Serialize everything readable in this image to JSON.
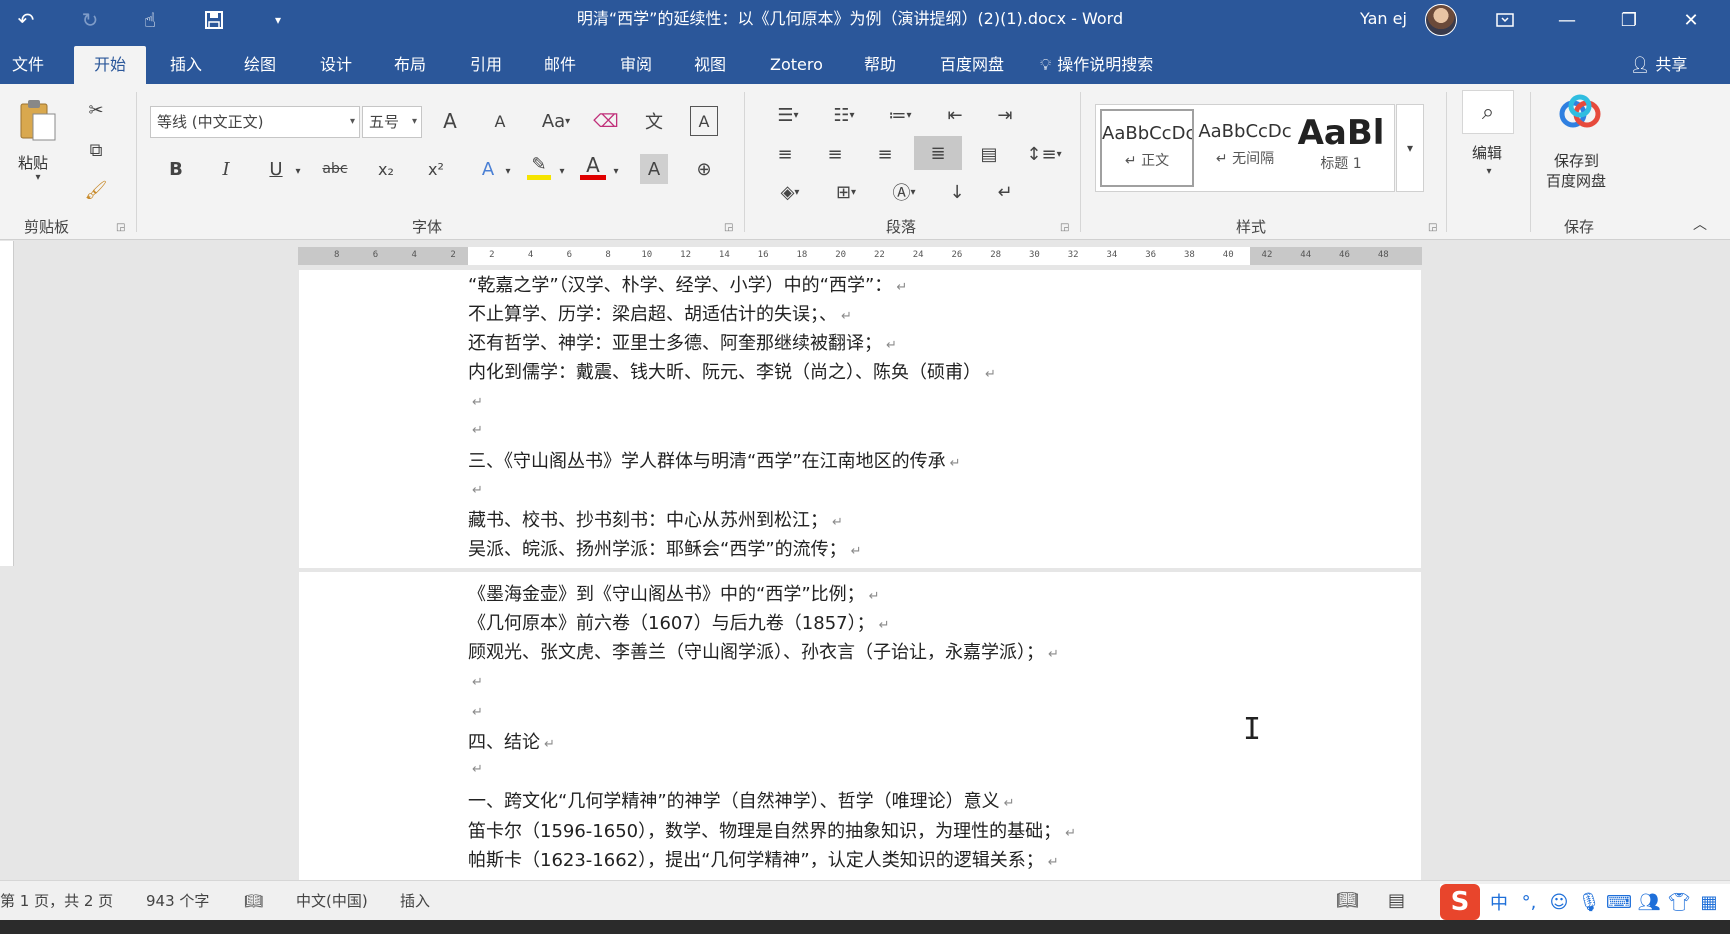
{
  "titlebar": {
    "title": "明清“西学”的延续性：以《几何原本》为例（演讲提纲）(2)(1).docx  -  Word",
    "user": "Yan ej",
    "icons": [
      "undo-icon",
      "redo-icon",
      "touch-mode-icon",
      "save-icon",
      "customize-icon"
    ]
  },
  "menu": {
    "tabs": [
      "文件",
      "开始",
      "插入",
      "绘图",
      "设计",
      "布局",
      "引用",
      "邮件",
      "审阅",
      "视图",
      "Zotero",
      "帮助",
      "百度网盘"
    ],
    "active": "开始",
    "search_label": "操作说明搜索",
    "share_label": "共享"
  },
  "ribbon": {
    "clipboard": {
      "paste_label": "粘贴",
      "group": "剪贴板"
    },
    "font": {
      "name": "等线 (中文正文)",
      "size": "五号",
      "group": "字体",
      "buttons": {
        "bold": "B",
        "italic": "I",
        "underline": "U",
        "strike": "abc",
        "sub": "x₂",
        "sup": "x²",
        "grow": "A",
        "shrink": "A",
        "case": "Aa",
        "color": "A",
        "shade": "A"
      },
      "colors": {
        "highlight": "#f5e400",
        "font_color": "#e00000"
      }
    },
    "paragraph": {
      "group": "段落"
    },
    "styles": {
      "group": "样式",
      "items": [
        {
          "sample": "AaBbCcDc",
          "name": "↵ 正文"
        },
        {
          "sample": "AaBbCcDc",
          "name": "↵ 无间隔"
        },
        {
          "sample": "AaBl",
          "name": "标题 1"
        }
      ]
    },
    "editing": {
      "label": "编辑"
    },
    "save": {
      "label_line1": "保存到",
      "label_line2": "百度网盘",
      "group": "保存"
    }
  },
  "ruler": {
    "ticks": [
      "8",
      "6",
      "4",
      "2",
      "2",
      "4",
      "6",
      "8",
      "10",
      "12",
      "14",
      "16",
      "18",
      "20",
      "22",
      "24",
      "26",
      "28",
      "30",
      "32",
      "34",
      "36",
      "38",
      "40",
      "42",
      "44",
      "46",
      "48"
    ]
  },
  "document": {
    "lines": [
      {
        "text": "“乾嘉之学”（汉学、朴学、经学、小学）中的“西学”："
      },
      {
        "text": "不止算学、历学：梁启超、胡适估计的失误；、"
      },
      {
        "text": "还有哲学、神学：亚里士多德、阿奎那继续被翻译；"
      },
      {
        "text": "内化到儒学：戴震、钱大昕、阮元、李锐（尚之）、陈奂（硕甫）"
      },
      {
        "text": ""
      },
      {
        "text": ""
      },
      {
        "text": "三、《守山阁丛书》学人群体与明清“西学”在江南地区的传承"
      },
      {
        "text": ""
      },
      {
        "text": "藏书、校书、抄书刻书：中心从苏州到松江；"
      },
      {
        "text": "吴派、皖派、扬州学派：耶稣会“西学”的流传；"
      },
      {
        "text": "《墨海金壶》到《守山阁丛书》中的“西学”比例；"
      },
      {
        "text": "《几何原本》前六卷（1607）与后九卷（1857）；"
      },
      {
        "text": "顾观光、张文虎、李善兰（守山阁学派）、孙衣言（子诒让，永嘉学派）；"
      },
      {
        "text": ""
      },
      {
        "text": ""
      },
      {
        "text": "四、结论"
      },
      {
        "text": ""
      },
      {
        "text": "一、跨文化“几何学精神”的神学（自然神学）、哲学（唯理论）意义"
      },
      {
        "text": "笛卡尔（1596-1650），数学、物理是自然界的抽象知识，为理性的基础；"
      },
      {
        "text": "帕斯卡（1623-1662），提出“几何学精神”，认定人类知识的逻辑关系；"
      }
    ],
    "paragraph_mark": "↵"
  },
  "status": {
    "page": "第 1 页，共 2 页",
    "words": "943 个字",
    "language": "中文(中国)",
    "mode": "插入"
  },
  "ime": {
    "mode": "中",
    "punct": "°,"
  }
}
